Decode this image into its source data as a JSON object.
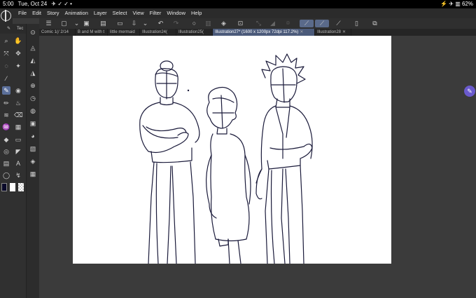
{
  "statusbar": {
    "time": "5:00",
    "date": "Tue, Oct 24",
    "notif_icons": "✈ ✓ ✓ •",
    "battery": "62%",
    "right_icons": "⚡ ✈ ▥"
  },
  "menu": {
    "items": [
      "File",
      "Edit",
      "Story",
      "Animation",
      "Layer",
      "Select",
      "View",
      "Filter",
      "Window",
      "Help"
    ]
  },
  "tool_panel": {
    "label": "Tec"
  },
  "tabs": [
    {
      "label": "Comic 1(/ 2/14",
      "active": false
    },
    {
      "label": "B and M with t",
      "active": false
    },
    {
      "label": "little mermaid",
      "active": false
    },
    {
      "label": "Illustration24(",
      "active": false
    },
    {
      "label": "Illustration25(",
      "active": false
    },
    {
      "label": "Illustration27* (1600 x 1200px 72dpi 117.2%)",
      "active": true
    },
    {
      "label": "Illustration28",
      "active": false
    }
  ],
  "colors": {
    "accent": "#5b6f9a",
    "active_tab": "#4b5a7a",
    "main_color": "#0a0a2a",
    "sub_color": "#ffffff",
    "float_button": "#6a5acd"
  }
}
